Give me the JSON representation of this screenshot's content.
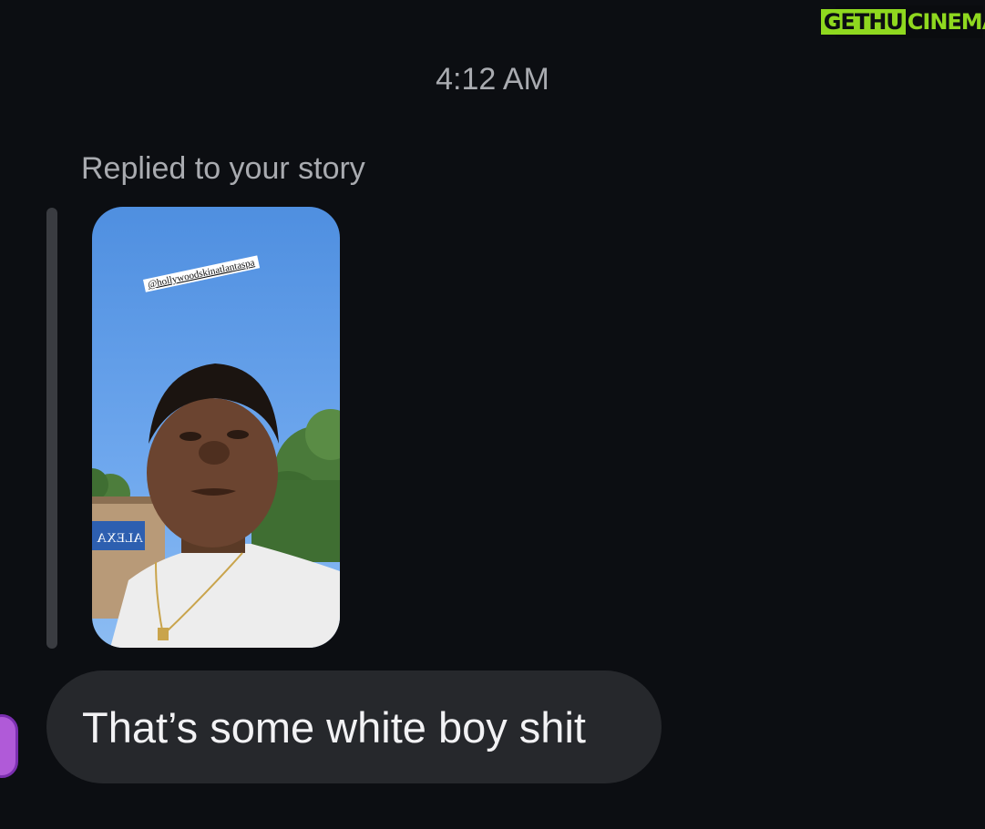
{
  "watermark": {
    "part_a": "GETHU",
    "part_b": "CINEMA"
  },
  "conversation": {
    "timestamp": "4:12 AM",
    "reply_context": "Replied to your story",
    "story": {
      "tag_text": "@hollywoodskinatlantaspa",
      "sign_text": "ALEXA"
    },
    "message": "That’s some white boy shit"
  },
  "colors": {
    "background": "#0c0e12",
    "bubble": "#26282c",
    "muted_text": "#a9abb0",
    "watermark_green": "#8fd81f"
  }
}
